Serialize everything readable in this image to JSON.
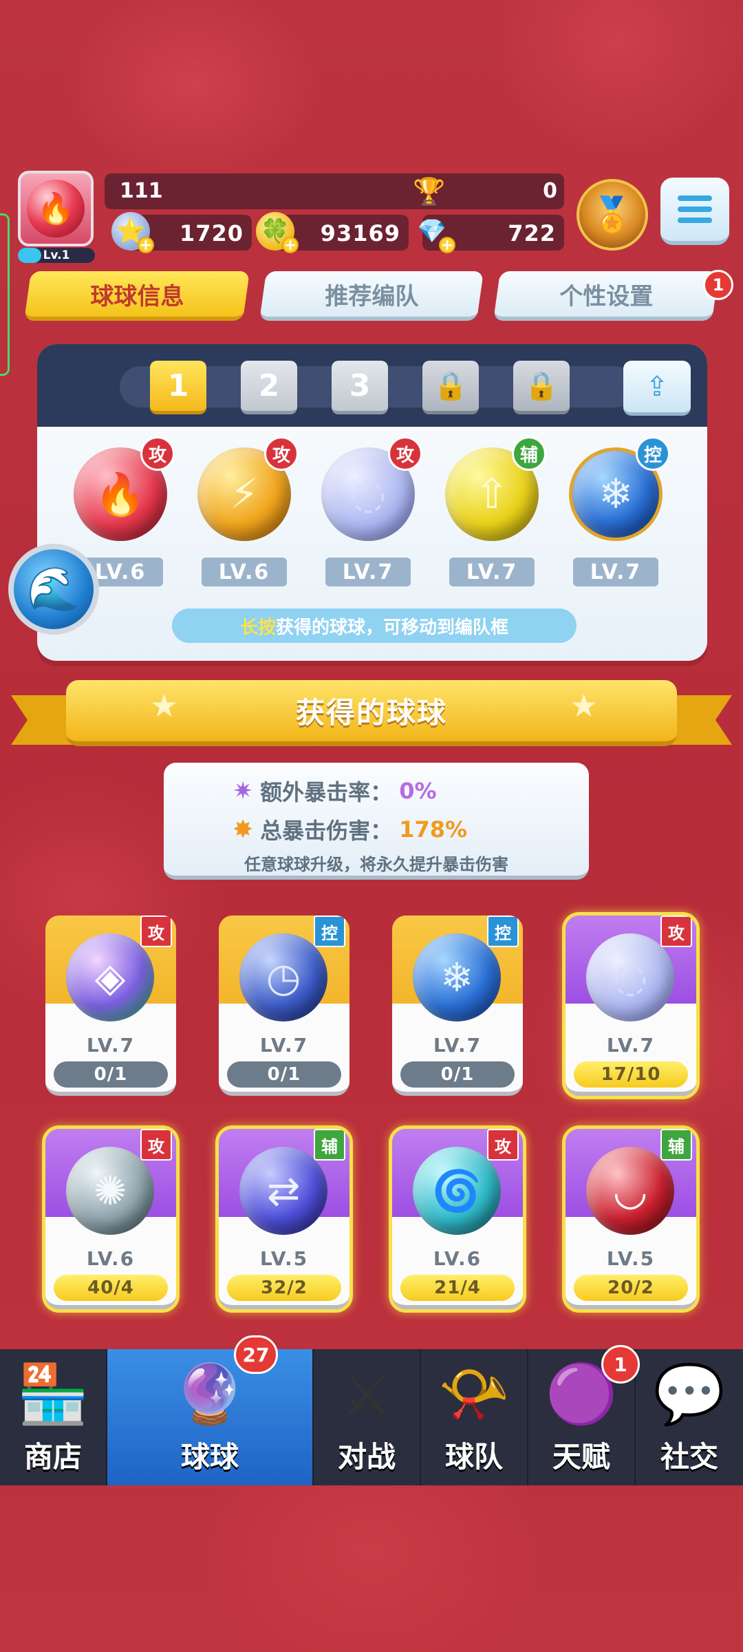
{
  "player": {
    "name": "111",
    "level": "Lv.1",
    "trophies": "0",
    "resources": [
      {
        "icon": "star-coin-icon",
        "value": "1720"
      },
      {
        "icon": "clover-coin-icon",
        "value": "93169"
      },
      {
        "icon": "diamond-icon",
        "value": "722"
      }
    ]
  },
  "top_tabs": [
    {
      "label": "球球信息",
      "active": true
    },
    {
      "label": "推荐编队",
      "active": false
    },
    {
      "label": "个性设置",
      "active": false,
      "badge": "1"
    }
  ],
  "lineup": {
    "slots": [
      "1",
      "2",
      "3",
      "lock",
      "lock"
    ],
    "active_slot": "1",
    "balls": [
      {
        "icon": "fire-ball-icon",
        "role": "攻",
        "level": "LV.6",
        "color": "#e63a4e"
      },
      {
        "icon": "lightning-ball-icon",
        "role": "攻",
        "level": "LV.6",
        "color": "#f0a51d"
      },
      {
        "icon": "bubble-ball-icon",
        "role": "攻",
        "level": "LV.7",
        "color": "#aab4f0"
      },
      {
        "icon": "arrow-up-ball-icon",
        "role": "辅",
        "level": "LV.7",
        "color": "#e9d21a"
      },
      {
        "icon": "snowflake-ball-icon",
        "role": "控",
        "level": "LV.7",
        "color": "#2a70d6"
      }
    ],
    "hint_highlight": "长按",
    "hint_text": "获得的球球，可移动到编队框"
  },
  "section_title": "获得的球球",
  "crit": {
    "extra_rate_label": "额外暴击率：",
    "extra_rate_value": "0%",
    "total_damage_label": "总暴击伤害：",
    "total_damage_value": "178%",
    "note": "任意球球升级，将永久提升暴击伤害"
  },
  "owned_balls": [
    {
      "icon": "prism-ball-icon",
      "role": "攻",
      "level": "LV.7",
      "progress": "0/1",
      "style": "gold",
      "color": "#7b5fe0"
    },
    {
      "icon": "clock-ball-icon",
      "role": "控",
      "level": "LV.7",
      "progress": "0/1",
      "style": "gold",
      "color": "#3d5cc7"
    },
    {
      "icon": "snowflake-ball-icon",
      "role": "控",
      "level": "LV.7",
      "progress": "0/1",
      "style": "gold",
      "color": "#2a70d6"
    },
    {
      "icon": "bubble-ball-icon",
      "role": "攻",
      "level": "LV.7",
      "progress": "17/10",
      "style": "purple",
      "color": "#aab4f0"
    },
    {
      "icon": "fan-ball-icon",
      "role": "攻",
      "level": "LV.6",
      "progress": "40/4",
      "style": "purple",
      "color": "#8fa4ad"
    },
    {
      "icon": "swap-ball-icon",
      "role": "辅",
      "level": "LV.5",
      "progress": "32/2",
      "style": "purple",
      "color": "#4e4fd8"
    },
    {
      "icon": "vortex-ball-icon",
      "role": "攻",
      "level": "LV.6",
      "progress": "21/4",
      "style": "purple",
      "color": "#2fb9c8"
    },
    {
      "icon": "fang-ball-icon",
      "role": "辅",
      "level": "LV.5",
      "progress": "20/2",
      "style": "purple",
      "color": "#c8202e"
    }
  ],
  "bottom_nav": [
    {
      "label": "商店",
      "icon": "shop-icon"
    },
    {
      "label": "球球",
      "icon": "balls-icon",
      "active": true,
      "badge": "27"
    },
    {
      "label": "对战",
      "icon": "crossed-swords-icon"
    },
    {
      "label": "球队",
      "icon": "whistle-icon"
    },
    {
      "label": "天赋",
      "icon": "talent-orb-icon",
      "badge": "1"
    },
    {
      "label": "社交",
      "icon": "chat-heart-icon"
    }
  ],
  "colors": {
    "background": "#b92f3a",
    "attack_role": "#d8333c",
    "support_role": "#3ea63f",
    "control_role": "#2a93d8",
    "accent_yellow": "#f5c21b"
  }
}
